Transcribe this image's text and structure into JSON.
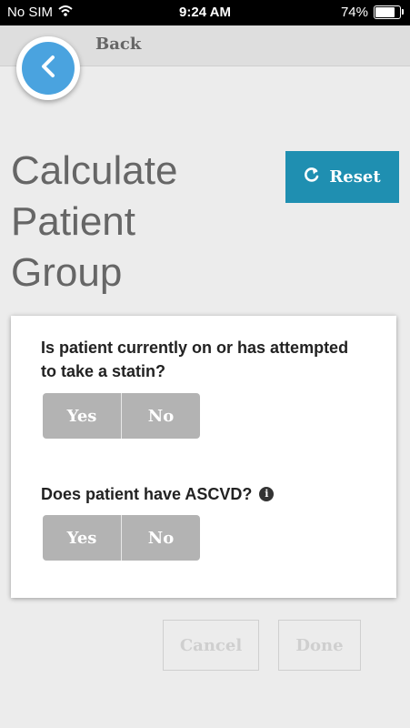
{
  "status_bar": {
    "carrier": "No SIM",
    "time": "9:24 AM",
    "battery": "74%"
  },
  "nav": {
    "back_label": "Back"
  },
  "page": {
    "title": "Calculate Patient Group"
  },
  "reset": {
    "label": "Reset"
  },
  "questions": [
    {
      "text": "Is patient currently on or has attempted to take a statin?",
      "yes": "Yes",
      "no": "No"
    },
    {
      "text": "Does patient have ASCVD?",
      "yes": "Yes",
      "no": "No"
    }
  ],
  "info": {
    "glyph": "i"
  },
  "footer": {
    "cancel": "Cancel",
    "done": "Done"
  },
  "colors": {
    "accent_blue": "#4aa3df",
    "reset_teal": "#1f8fb1",
    "segment_gray": "#b3b3b3"
  }
}
